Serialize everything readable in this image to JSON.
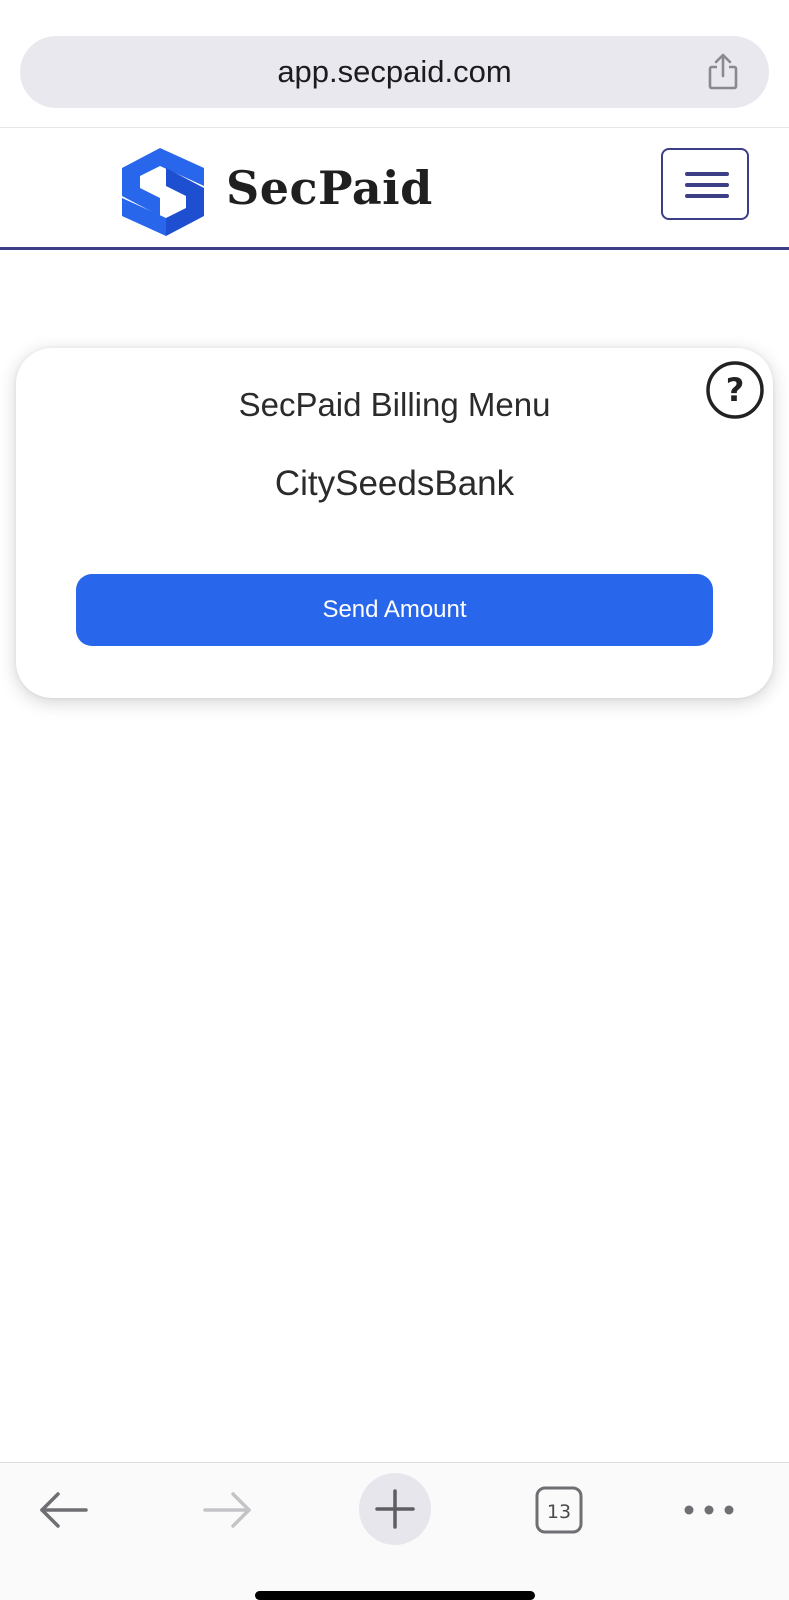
{
  "browser": {
    "url": "app.secpaid.com",
    "tabs_count": "13"
  },
  "navbar": {
    "brand": "SecPaid",
    "logo_colors": [
      "#2866ec",
      "#1e4fd1"
    ]
  },
  "card": {
    "title": "SecPaid Billing Menu",
    "subtitle": "CitySeedsBank",
    "send_button": "Send Amount",
    "help_symbol": "?"
  },
  "colors": {
    "accent": "#2866ec",
    "navbar_border": "#3d3f86"
  },
  "icons": [
    "share-icon",
    "menu-icon",
    "help-icon",
    "back-arrow-icon",
    "forward-arrow-icon",
    "plus-icon",
    "tabs-icon",
    "more-icon"
  ]
}
